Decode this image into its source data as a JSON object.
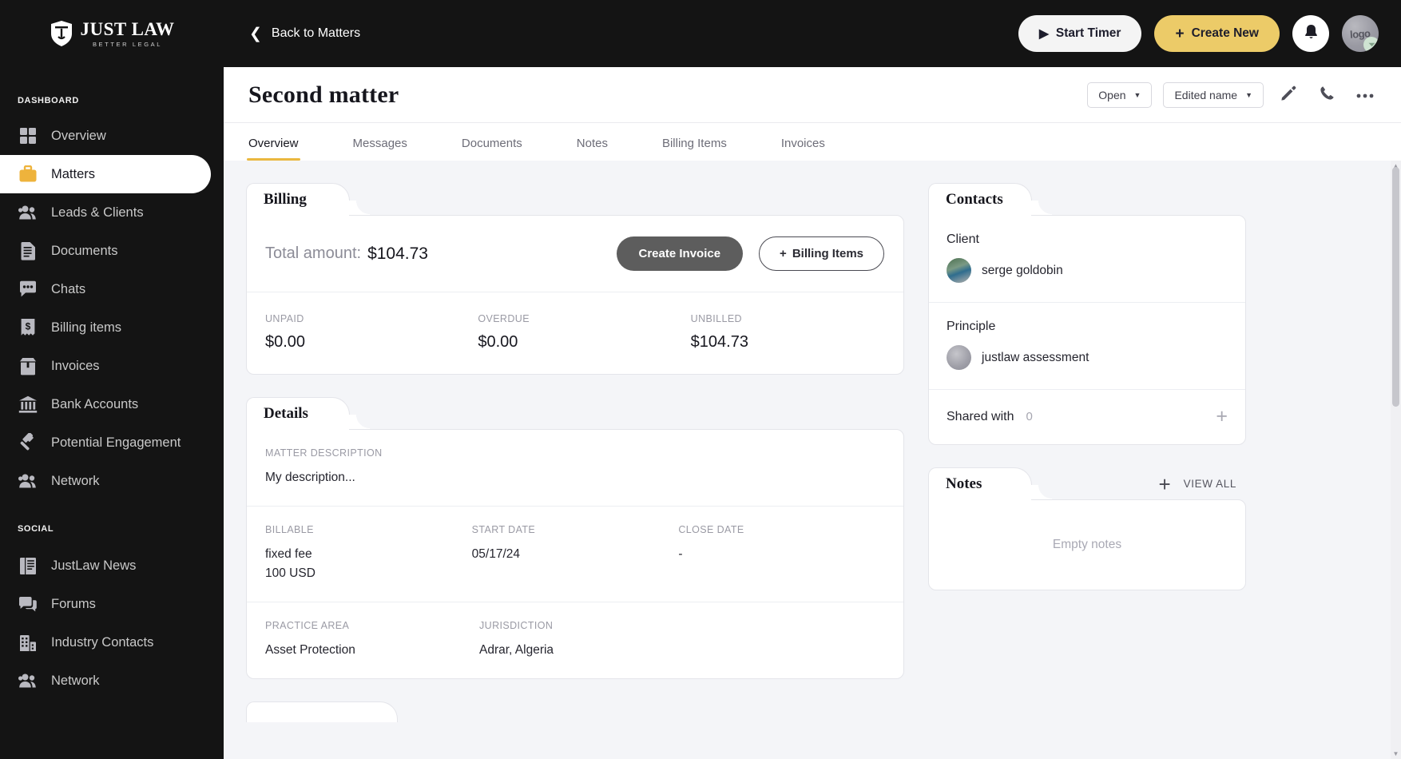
{
  "brand": {
    "name": "JUST LAW",
    "tagline": "BETTER LEGAL"
  },
  "sidebar": {
    "sections": [
      {
        "label": "DASHBOARD",
        "items": [
          {
            "label": "Overview",
            "icon": "grid-icon",
            "active": false
          },
          {
            "label": "Matters",
            "icon": "briefcase-icon",
            "active": true
          },
          {
            "label": "Leads & Clients",
            "icon": "people-icon",
            "active": false
          },
          {
            "label": "Documents",
            "icon": "document-icon",
            "active": false
          },
          {
            "label": "Chats",
            "icon": "chat-bubble-icon",
            "active": false
          },
          {
            "label": "Billing items",
            "icon": "receipt-dollar-icon",
            "active": false
          },
          {
            "label": "Invoices",
            "icon": "invoice-box-icon",
            "active": false
          },
          {
            "label": "Bank Accounts",
            "icon": "bank-icon",
            "active": false
          },
          {
            "label": "Potential Engagement",
            "icon": "gavel-icon",
            "active": false
          },
          {
            "label": "Network",
            "icon": "people-icon",
            "active": false
          }
        ]
      },
      {
        "label": "SOCIAL",
        "items": [
          {
            "label": "JustLaw News",
            "icon": "newspaper-icon",
            "active": false
          },
          {
            "label": "Forums",
            "icon": "forum-icon",
            "active": false
          },
          {
            "label": "Industry Contacts",
            "icon": "building-icon",
            "active": false
          },
          {
            "label": "Network",
            "icon": "people-icon",
            "active": false
          }
        ]
      }
    ]
  },
  "topbar": {
    "back_label": "Back to Matters",
    "start_timer_label": "Start Timer",
    "create_new_label": "Create New",
    "avatar_text": "logo"
  },
  "matter": {
    "title": "Second matter",
    "status_label": "Open",
    "name_label": "Edited name"
  },
  "tabs": [
    {
      "label": "Overview",
      "active": true
    },
    {
      "label": "Messages",
      "active": false
    },
    {
      "label": "Documents",
      "active": false
    },
    {
      "label": "Notes",
      "active": false
    },
    {
      "label": "Billing Items",
      "active": false
    },
    {
      "label": "Invoices",
      "active": false
    }
  ],
  "billing": {
    "card_title": "Billing",
    "total_label": "Total amount:",
    "total_value": "$104.73",
    "create_invoice_label": "Create Invoice",
    "billing_items_label": "Billing Items",
    "stats": [
      {
        "label": "UNPAID",
        "value": "$0.00"
      },
      {
        "label": "OVERDUE",
        "value": "$0.00"
      },
      {
        "label": "UNBILLED",
        "value": "$104.73"
      }
    ]
  },
  "details": {
    "card_title": "Details",
    "description_label": "MATTER DESCRIPTION",
    "description_value": "My description...",
    "billable_label": "BILLABLE",
    "billable_value": "fixed fee",
    "billable_amount": "100 USD",
    "start_date_label": "START DATE",
    "start_date_value": "05/17/24",
    "close_date_label": "CLOSE DATE",
    "close_date_value": "-",
    "practice_area_label": "PRACTICE AREA",
    "practice_area_value": "Asset Protection",
    "jurisdiction_label": "JURISDICTION",
    "jurisdiction_value": "Adrar, Algeria"
  },
  "contacts": {
    "card_title": "Contacts",
    "client_role": "Client",
    "client_name": "serge goldobin",
    "principle_role": "Principle",
    "principle_name": "justlaw assessment",
    "shared_with_label": "Shared with",
    "shared_with_count": "0"
  },
  "notes": {
    "card_title": "Notes",
    "view_all_label": "VIEW ALL",
    "empty_label": "Empty notes"
  },
  "colors": {
    "accent": "#eccb68",
    "tab_underline": "#eab83f",
    "sidebar_bg": "#141414",
    "page_bg": "#f4f5f8"
  }
}
